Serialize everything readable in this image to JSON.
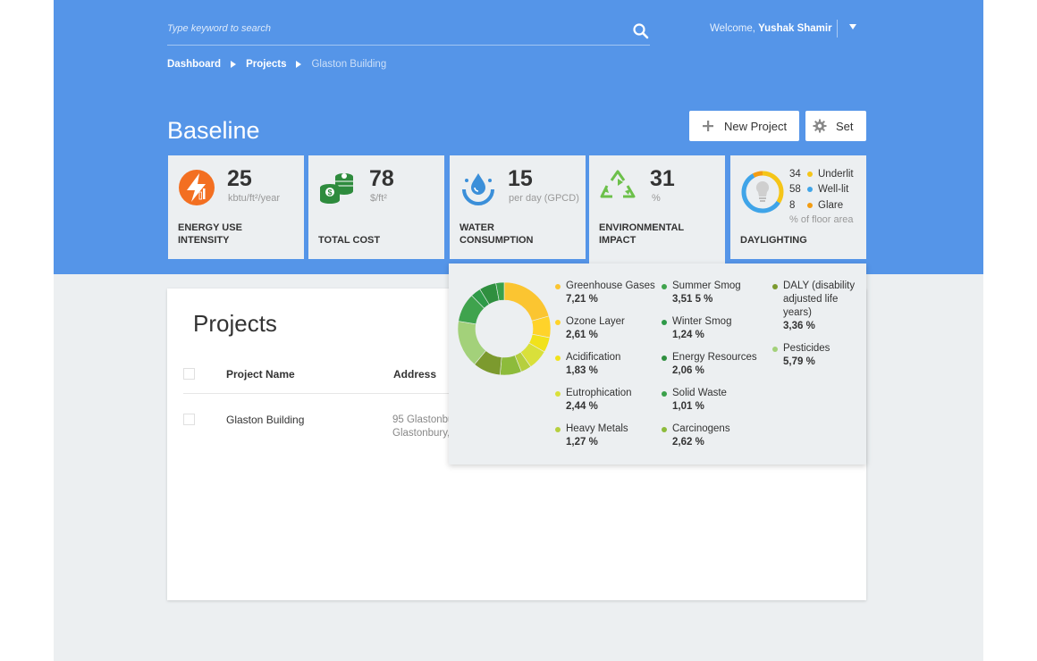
{
  "search": {
    "placeholder": "Type keyword to search",
    "icon": "search-icon"
  },
  "user": {
    "welcome": "Welcome, ",
    "name": "Yushak Shamir"
  },
  "breadcrumb": [
    {
      "label": "Dashboard"
    },
    {
      "label": "Projects"
    },
    {
      "label": "Glaston Building"
    }
  ],
  "page": {
    "title": "Baseline"
  },
  "toolbar": {
    "new_project_label": "New Project",
    "set_label": "Set"
  },
  "metrics": {
    "energy": {
      "value": "25",
      "unit": "kbtu/ft²/year",
      "label_line1": "ENERGY USE",
      "label_line2": "INTENSITY",
      "icon": "energy-bolt-icon",
      "color": "#f36f21"
    },
    "cost": {
      "value": "78",
      "unit": "$/ft²",
      "label": "TOTAL COST",
      "icon": "money-stack-icon",
      "color": "#2e8b3d"
    },
    "water": {
      "value": "15",
      "unit": "per day (GPCD)",
      "label_line1": "WATER",
      "label_line2": "CONSUMPTION",
      "icon": "water-drop-icon",
      "color": "#3b8fd9"
    },
    "environment": {
      "value": "31",
      "unit": "%",
      "label_line1": "ENVIRONMENTAL",
      "label_line2": "IMPACT",
      "icon": "recycle-icon",
      "color": "#6cc04a"
    },
    "daylighting": {
      "label": "DAYLIGHTING",
      "icon": "bulb-gauge-icon",
      "note": "% of floor area",
      "rows": [
        {
          "value": "34",
          "name": "Underlit",
          "color": "#f5c518"
        },
        {
          "value": "58",
          "name": "Well-lit",
          "color": "#3fa4e8"
        },
        {
          "value": "8",
          "name": "Glare",
          "color": "#f39c12"
        }
      ]
    }
  },
  "projects": {
    "title": "Projects",
    "columns": [
      "Project Name",
      "Address"
    ],
    "rows": [
      {
        "name": "Glaston Building",
        "address_line1": "95 Glastonbu",
        "address_line2": "Glastonbury,"
      }
    ]
  },
  "environmental_breakdown": [
    {
      "name": "Greenhouse Gases",
      "value": "7,21 %",
      "color": "#fbc531"
    },
    {
      "name": "Ozone Layer",
      "value": "2,61 %",
      "color": "#ffd32a"
    },
    {
      "name": "Acidification",
      "value": "1,83 %",
      "color": "#f1e21b"
    },
    {
      "name": "Eutrophication",
      "value": "2,44 %",
      "color": "#d9e03a"
    },
    {
      "name": "Heavy Metals",
      "value": "1,27 %",
      "color": "#b6cf3e"
    },
    {
      "name": "Summer Smog",
      "value": "3,51 5 %",
      "color": "#3fa34d"
    },
    {
      "name": "Winter Smog",
      "value": "1,24 %",
      "color": "#2e9a48"
    },
    {
      "name": "Energy Resources",
      "value": "2,06 %",
      "color": "#2f8f3f"
    },
    {
      "name": "Solid Waste",
      "value": "1,01 %",
      "color": "#3aa04a"
    },
    {
      "name": "Carcinogens",
      "value": "2,62 %",
      "color": "#8dbb3b"
    },
    {
      "name": "DALY (disability adjusted life years)",
      "value": "3,36 %",
      "color": "#7c9a2e"
    },
    {
      "name": "Pesticides",
      "value": "5,79 %",
      "color": "#a3d17a"
    }
  ],
  "colors": {
    "brand": "#5595e8",
    "card_bg": "#eceff1"
  }
}
